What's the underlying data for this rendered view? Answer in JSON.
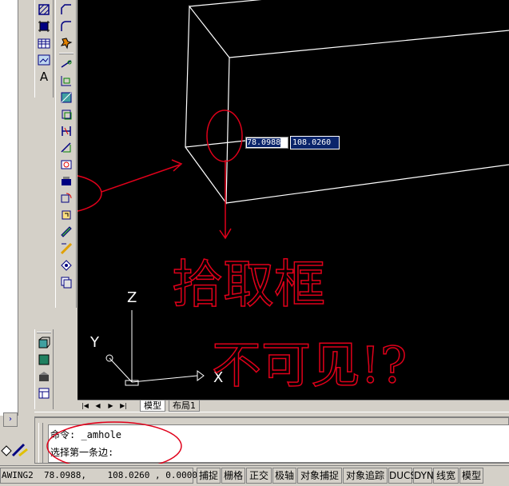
{
  "viewport": {
    "input_x": "78.0988",
    "input_y": "108.0260",
    "ucs": {
      "x_label": "X",
      "y_label": "Y",
      "z_label": "Z"
    },
    "annotation_line1": "拾取框",
    "annotation_line2": "不可见!?",
    "annotation_color": "#e0001a"
  },
  "tabs": [
    {
      "label": "模型",
      "active": true
    },
    {
      "label": "布局1",
      "active": false
    }
  ],
  "command": {
    "line1": "命令: _amhole",
    "line2": "选择第一条边:"
  },
  "status": {
    "coords": "AWING2  78.0988,    108.0260 , 0.0000",
    "buttons": [
      "捕捉",
      "栅格",
      "正交",
      "极轴",
      "对象捕捉",
      "对象追踪",
      "DUCS",
      "DYN",
      "线宽",
      "模型"
    ]
  },
  "toolbar_icons": {
    "toolbar1": [
      "hatch-icon",
      "region-icon",
      "table-icon",
      "text-icon"
    ],
    "toolbar2": [
      "chamfer-icon",
      "fillet-icon",
      "explode-icon",
      "dimension-icon",
      "leader-icon",
      "hole-icon",
      "block-icon",
      "mirror-icon",
      "scale-icon",
      "offset-icon",
      "trim-icon",
      "measure-icon",
      "hole-circle-icon",
      "layer-icon",
      "rotate-icon",
      "stretch-icon",
      "edit-icon",
      "properties-icon",
      "array-icon",
      "copy-icon"
    ]
  }
}
